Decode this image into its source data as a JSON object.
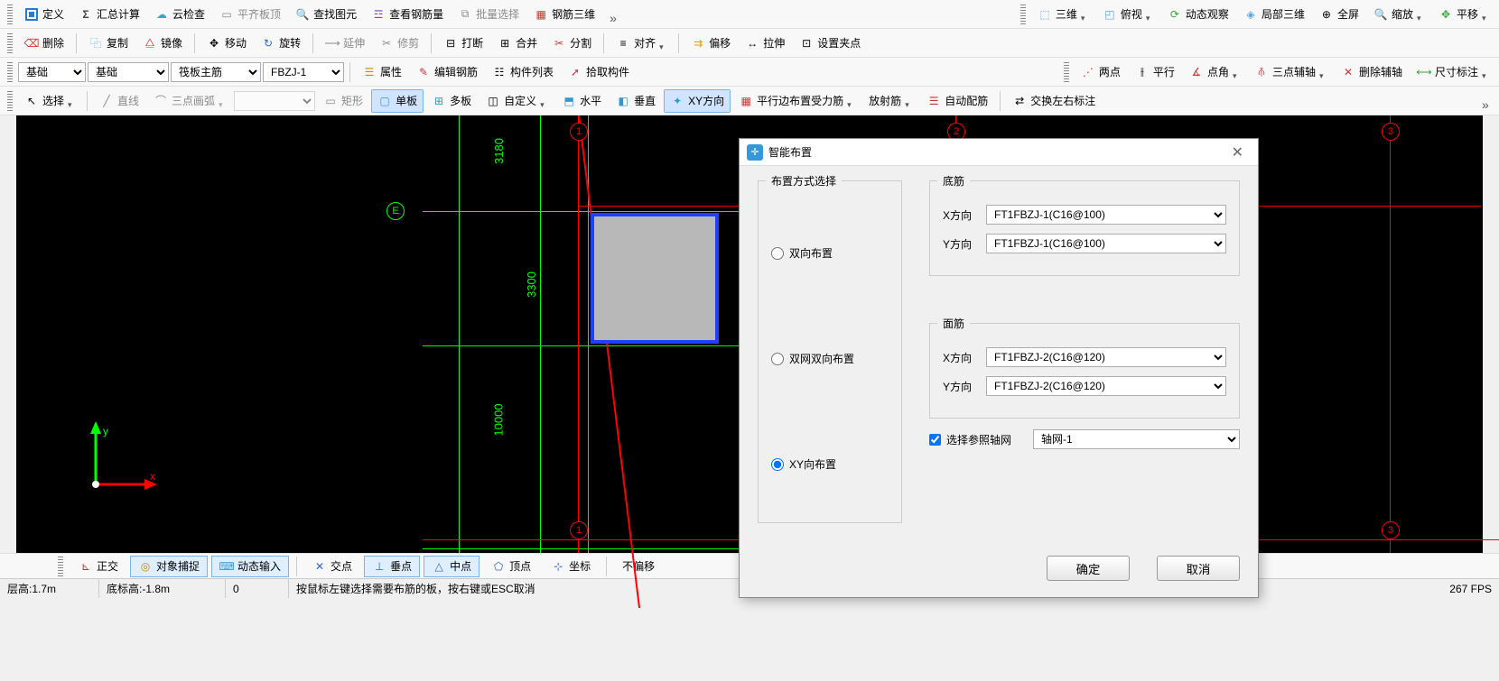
{
  "toolbar_rows": [
    {
      "groups": [
        [
          {
            "icon": "define",
            "label": "定义",
            "name": "define-button"
          },
          {
            "icon": "sigma",
            "label": "汇总计算",
            "name": "sum-calc-button"
          },
          {
            "icon": "cloud",
            "label": "云检查",
            "name": "cloud-check-button"
          },
          {
            "icon": "flat-top",
            "label": "平齐板顶",
            "name": "flat-top-button",
            "disabled": true
          },
          {
            "icon": "find",
            "label": "查找图元",
            "name": "find-element-button"
          },
          {
            "icon": "rebar",
            "label": "查看钢筋量",
            "name": "view-rebar-button"
          },
          {
            "icon": "batch",
            "label": "批量选择",
            "name": "batch-select-button",
            "disabled": true
          },
          {
            "icon": "rebar3d",
            "label": "钢筋三维",
            "name": "rebar-3d-button"
          },
          {
            "icon": "more",
            "label": "",
            "name": "more-1",
            "arrow": "big"
          }
        ],
        [
          {
            "icon": "cube",
            "label": "三维",
            "name": "3d-view-button",
            "arrow": true
          },
          {
            "icon": "cubetop",
            "label": "俯视",
            "name": "top-view-button",
            "arrow": true
          },
          {
            "icon": "orbit",
            "label": "动态观察",
            "name": "orbit-button"
          },
          {
            "icon": "local3d",
            "label": "局部三维",
            "name": "local-3d-button"
          },
          {
            "icon": "fullscreen",
            "label": "全屏",
            "name": "fullscreen-button"
          },
          {
            "icon": "zoom",
            "label": "缩放",
            "name": "zoom-button",
            "arrow": true
          },
          {
            "icon": "pan",
            "label": "平移",
            "name": "pan-button",
            "arrow": true
          }
        ]
      ]
    },
    {
      "groups": [
        [
          {
            "icon": "delete",
            "label": "删除",
            "name": "delete-button"
          },
          {
            "icon": "copy",
            "label": "复制",
            "name": "copy-button"
          },
          {
            "icon": "mirror",
            "label": "镜像",
            "name": "mirror-button"
          },
          {
            "icon": "move",
            "label": "移动",
            "name": "move-button"
          },
          {
            "icon": "rotate",
            "label": "旋转",
            "name": "rotate-button"
          },
          {
            "icon": "extend",
            "label": "延伸",
            "name": "extend-button",
            "disabled": true
          },
          {
            "icon": "trim",
            "label": "修剪",
            "name": "trim-button",
            "disabled": true
          },
          {
            "icon": "break",
            "label": "打断",
            "name": "break-button"
          },
          {
            "icon": "merge",
            "label": "合并",
            "name": "merge-button"
          },
          {
            "icon": "split",
            "label": "分割",
            "name": "split-button"
          },
          {
            "icon": "align",
            "label": "对齐",
            "name": "align-button",
            "arrow": true
          },
          {
            "icon": "offset",
            "label": "偏移",
            "name": "offset-button"
          },
          {
            "icon": "stretch",
            "label": "拉伸",
            "name": "stretch-button"
          },
          {
            "icon": "setnode",
            "label": "设置夹点",
            "name": "set-node-button"
          }
        ]
      ]
    }
  ],
  "combos": {
    "category1": "基础",
    "category2": "基础",
    "category3": "筏板主筋",
    "category4": "FBZJ-1"
  },
  "toolbar3_right": [
    {
      "icon": "props",
      "label": "属性",
      "name": "properties-button"
    },
    {
      "icon": "editrebar",
      "label": "编辑钢筋",
      "name": "edit-rebar-button"
    },
    {
      "icon": "list",
      "label": "构件列表",
      "name": "component-list-button"
    },
    {
      "icon": "pick",
      "label": "拾取构件",
      "name": "pick-component-button"
    }
  ],
  "toolbar3_far": [
    {
      "icon": "twopt",
      "label": "两点",
      "name": "two-point-button"
    },
    {
      "icon": "parallel",
      "label": "平行",
      "name": "parallel-button"
    },
    {
      "icon": "angle",
      "label": "点角",
      "name": "angle-button",
      "arrow": true
    },
    {
      "icon": "aux3",
      "label": "三点辅轴",
      "name": "three-point-aux-button",
      "arrow": true
    },
    {
      "icon": "delaux",
      "label": "删除辅轴",
      "name": "delete-aux-button"
    },
    {
      "icon": "dim",
      "label": "尺寸标注",
      "name": "dimension-button",
      "arrow": true
    }
  ],
  "toolbar4": [
    {
      "icon": "select",
      "label": "选择",
      "name": "select-button",
      "arrow": true
    },
    {
      "icon": "line",
      "label": "直线",
      "name": "line-button",
      "disabled": true
    },
    {
      "icon": "arc",
      "label": "三点画弧",
      "name": "arc-button",
      "arrow": true,
      "disabled": true
    },
    {
      "type": "combo",
      "name": "draw-combo"
    },
    {
      "icon": "rect",
      "label": "矩形",
      "name": "rect-button",
      "disabled": true
    },
    {
      "icon": "single",
      "label": "单板",
      "name": "single-plate-button",
      "active": true
    },
    {
      "icon": "multi",
      "label": "多板",
      "name": "multi-plate-button"
    },
    {
      "icon": "custom",
      "label": "自定义",
      "name": "custom-button",
      "arrow": true
    },
    {
      "icon": "horiz",
      "label": "水平",
      "name": "horizontal-button"
    },
    {
      "icon": "vert",
      "label": "垂直",
      "name": "vertical-button"
    },
    {
      "icon": "xy",
      "label": "XY方向",
      "name": "xy-direction-button",
      "active": true
    },
    {
      "icon": "paralleledge",
      "label": "平行边布置受力筋",
      "name": "parallel-edge-button",
      "arrow": true
    },
    {
      "icon": "radial",
      "label": "放射筋",
      "name": "radial-rebar-button",
      "arrow": true
    },
    {
      "icon": "auto",
      "label": "自动配筋",
      "name": "auto-rebar-button"
    },
    {
      "icon": "swap",
      "label": "交换左右标注",
      "name": "swap-annotation-button"
    },
    {
      "icon": "more",
      "label": "",
      "name": "more-4",
      "arrow": "big"
    }
  ],
  "canvas": {
    "dims": {
      "d1": "3180",
      "d2": "3300",
      "d3": "10000"
    },
    "axis_labels": {
      "x": "x",
      "y": "y"
    },
    "bubbles": {
      "E": "E",
      "b1": "1",
      "b2": "2",
      "b3": "3",
      "b1b": "1",
      "b3b": "3"
    }
  },
  "dialog": {
    "title": "智能布置",
    "group_layout": "布置方式选择",
    "radio_bi": "双向布置",
    "radio_dual": "双网双向布置",
    "radio_xy": "XY向布置",
    "group_bottom": "底筋",
    "group_top": "面筋",
    "lbl_x": "X方向",
    "lbl_y": "Y方向",
    "bottom_x": "FT1FBZJ-1(C16@100)",
    "bottom_y": "FT1FBZJ-1(C16@100)",
    "top_x": "FT1FBZJ-2(C16@120)",
    "top_y": "FT1FBZJ-2(C16@120)",
    "chk_axis": "选择参照轴网",
    "axis_grid": "轴网-1",
    "ok": "确定",
    "cancel": "取消"
  },
  "status_row": [
    {
      "icon": "ortho",
      "label": "正交",
      "name": "ortho-toggle"
    },
    {
      "icon": "snap",
      "label": "对象捕捉",
      "name": "snap-toggle",
      "active": true
    },
    {
      "icon": "dyninput",
      "label": "动态输入",
      "name": "dynamic-input-toggle",
      "active": true
    },
    {
      "icon": "intersect",
      "label": "交点",
      "name": "intersection-snap"
    },
    {
      "icon": "perp",
      "label": "垂点",
      "name": "perpendicular-snap",
      "active": true
    },
    {
      "icon": "mid",
      "label": "中点",
      "name": "midpoint-snap",
      "active": true
    },
    {
      "icon": "vertex",
      "label": "顶点",
      "name": "vertex-snap"
    },
    {
      "icon": "coord",
      "label": "坐标",
      "name": "coord-snap"
    },
    {
      "icon": "nooffset",
      "label": "不偏移",
      "name": "no-offset-toggle"
    }
  ],
  "status_bar": {
    "floor_h_label": "层高:",
    "floor_h": "1.7m",
    "base_h_label": "底标高:",
    "base_h": "-1.8m",
    "coord": "0",
    "prompt": "按鼠标左键选择需要布筋的板，按右键或ESC取消",
    "fps": "267 FPS"
  }
}
